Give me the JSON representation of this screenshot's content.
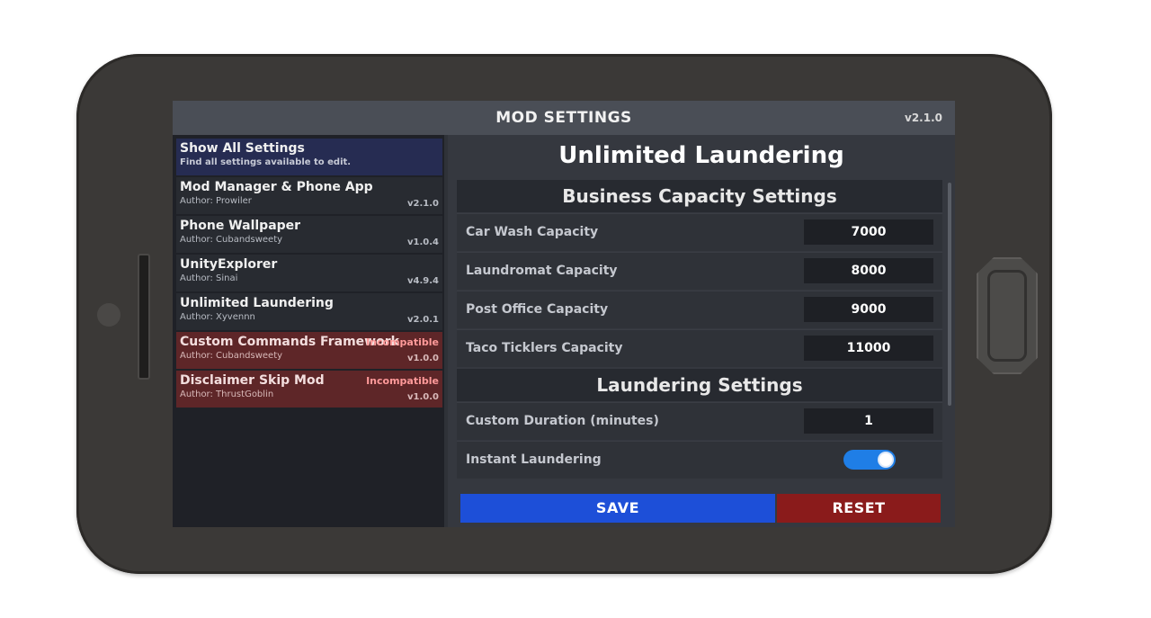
{
  "header": {
    "title": "MOD SETTINGS",
    "version": "v2.1.0"
  },
  "sidebar": {
    "show_all": {
      "name": "Show All Settings",
      "desc": "Find all settings available to edit."
    },
    "mods": [
      {
        "name": "Mod Manager & Phone App",
        "author": "Author: Prowiler",
        "version": "v2.1.0",
        "badge": ""
      },
      {
        "name": "Phone Wallpaper",
        "author": "Author: Cubandsweety",
        "version": "v1.0.4",
        "badge": ""
      },
      {
        "name": "UnityExplorer",
        "author": "Author: Sinai",
        "version": "v4.9.4",
        "badge": ""
      },
      {
        "name": "Unlimited Laundering",
        "author": "Author: Xyvennn",
        "version": "v2.0.1",
        "badge": ""
      },
      {
        "name": "Custom Commands Framework",
        "author": "Author: Cubandsweety",
        "version": "v1.0.0",
        "badge": "Incompatible"
      },
      {
        "name": "Disclaimer Skip Mod",
        "author": "Author: ThrustGoblin",
        "version": "v1.0.0",
        "badge": "Incompatible"
      }
    ]
  },
  "main": {
    "mod_title": "Unlimited Laundering",
    "sections": [
      {
        "title": "Business Capacity Settings",
        "settings": [
          {
            "label": "Car Wash Capacity",
            "value": "7000"
          },
          {
            "label": "Laundromat Capacity",
            "value": "8000"
          },
          {
            "label": "Post Office Capacity",
            "value": "9000"
          },
          {
            "label": "Taco Ticklers Capacity",
            "value": "11000"
          }
        ]
      },
      {
        "title": "Laundering Settings",
        "settings": [
          {
            "label": "Custom Duration (minutes)",
            "value": "1"
          },
          {
            "label": "Instant Laundering",
            "toggle": true
          }
        ]
      }
    ],
    "buttons": {
      "save": "SAVE",
      "reset": "RESET"
    }
  },
  "colors": {
    "save": "#1d4fd8",
    "reset": "#8a1b1b",
    "toggle_on": "#1f7ee6",
    "incompatible": "#5e2628"
  },
  "icons": {
    "toggle": "toggle-switch-icon"
  }
}
